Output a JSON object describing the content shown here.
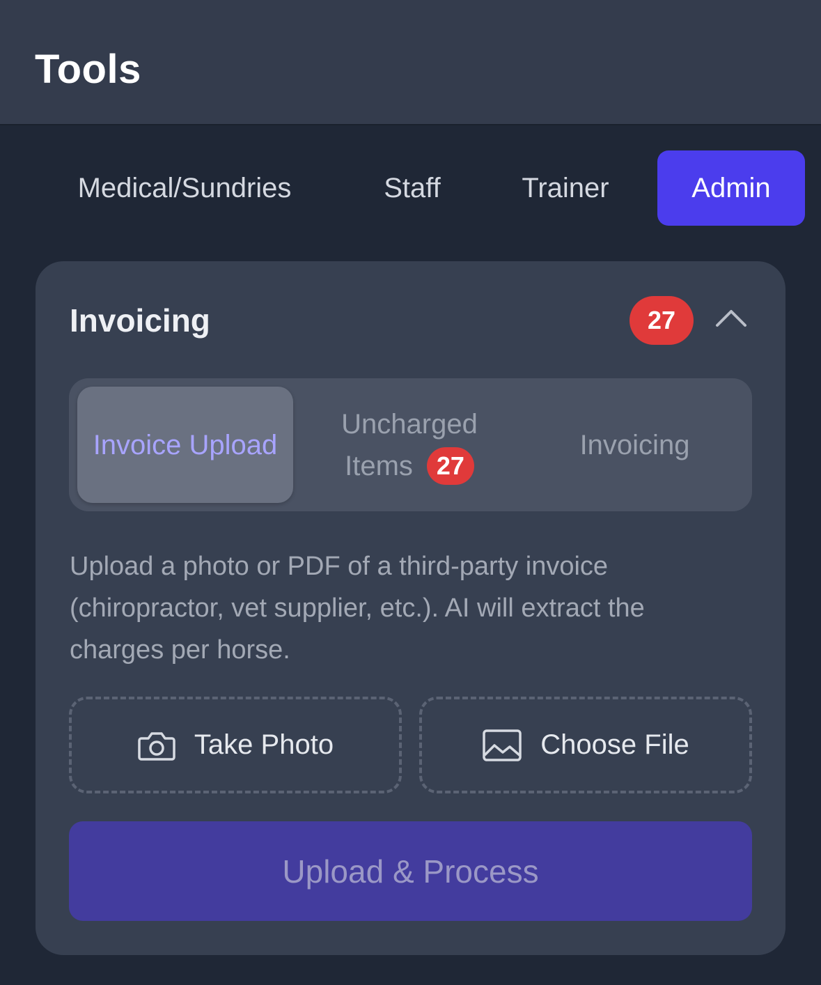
{
  "header": {
    "title": "Tools"
  },
  "top_tabs": [
    {
      "label": "Medical/Sundries",
      "active": false
    },
    {
      "label": "Staff",
      "active": false
    },
    {
      "label": "Trainer",
      "active": false
    },
    {
      "label": "Admin",
      "active": true
    }
  ],
  "card": {
    "title": "Invoicing",
    "badge_count": "27",
    "expanded": true,
    "sub_tabs": [
      {
        "label": "Invoice Upload",
        "active": true
      },
      {
        "label_line1": "Uncharged",
        "label_line2": "Items",
        "badge_count": "27",
        "active": false
      },
      {
        "label": "Invoicing",
        "active": false
      }
    ],
    "description": "Upload a photo or PDF of a third-party invoice (chiropractor, vet supplier, etc.). AI will extract the charges per horse.",
    "take_photo": {
      "label": "Take Photo",
      "icon": "camera-icon"
    },
    "choose_file": {
      "label": "Choose File",
      "icon": "image-icon"
    },
    "process_button": {
      "label": "Upload & Process",
      "enabled": false
    }
  },
  "colors": {
    "background": "#1f2736",
    "header": "#343c4d",
    "card": "#374051",
    "accent": "#4b3ded",
    "badge": "#e03a3a",
    "active_subtab_text": "#a8a4ff",
    "process_button": "#433c9e"
  }
}
